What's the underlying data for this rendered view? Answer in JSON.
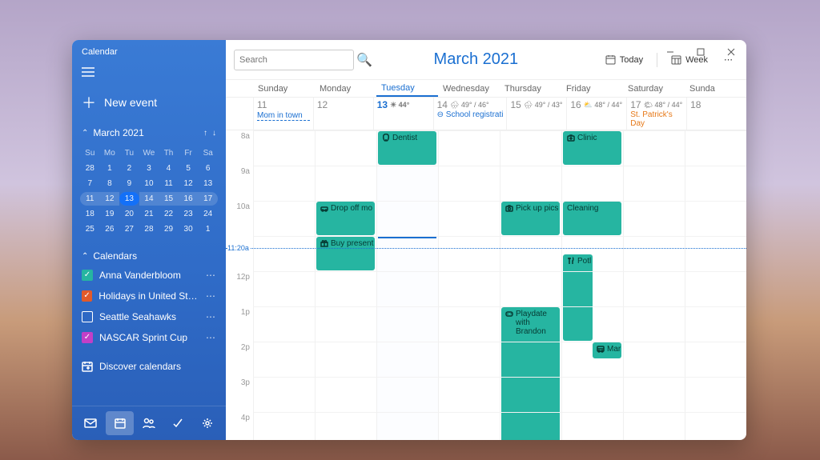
{
  "app": {
    "title": "Calendar"
  },
  "sidebar": {
    "newEvent": "New event",
    "month": "March 2021",
    "weekdays": [
      "Su",
      "Mo",
      "Tu",
      "We",
      "Th",
      "Fr",
      "Sa"
    ],
    "miniRows": [
      [
        "28",
        "1",
        "2",
        "3",
        "4",
        "5",
        "6"
      ],
      [
        "7",
        "8",
        "9",
        "10",
        "11",
        "12",
        "13"
      ],
      [
        "11",
        "12",
        "13",
        "14",
        "15",
        "16",
        "17"
      ],
      [
        "18",
        "19",
        "20",
        "21",
        "22",
        "23",
        "24"
      ],
      [
        "25",
        "26",
        "27",
        "28",
        "29",
        "30",
        "1"
      ]
    ],
    "todayIdx": [
      2,
      2
    ],
    "currentWeek": 2,
    "calendarsHeader": "Calendars",
    "calendars": [
      {
        "label": "Anna Vanderbloom",
        "color": "#26b5a1",
        "checked": true
      },
      {
        "label": "Holidays in United States",
        "color": "#e25a2a",
        "checked": true
      },
      {
        "label": "Seattle Seahawks",
        "color": "transparent",
        "checked": false
      },
      {
        "label": "NASCAR Sprint Cup",
        "color": "#c23fc7",
        "checked": true
      }
    ],
    "discover": "Discover calendars"
  },
  "toolbar": {
    "search_placeholder": "Search",
    "monthTitle": "March 2021",
    "today": "Today",
    "view": "Week"
  },
  "headers": [
    "Sunday",
    "Monday",
    "Tuesday",
    "Wednesday",
    "Thursday",
    "Friday",
    "Saturday",
    "Sunda"
  ],
  "todayCol": 2,
  "allday": [
    {
      "num": "11",
      "events": [
        {
          "text": "Mom in town",
          "dashed": true
        }
      ]
    },
    {
      "num": "12",
      "events": []
    },
    {
      "num": "13",
      "today": true,
      "weather": "☀ 44°",
      "events": []
    },
    {
      "num": "14",
      "weather": "🌧 49° / 46°",
      "events": [
        {
          "text": "⊖ School registrati",
          "link": true
        }
      ]
    },
    {
      "num": "15",
      "weather": "🌧 49° / 43°",
      "events": []
    },
    {
      "num": "16",
      "weather": "⛅ 48° / 44°",
      "events": []
    },
    {
      "num": "17",
      "weather": "🌤 48° / 44°",
      "events": [
        {
          "text": "St. Patrick's Day",
          "holiday": true
        }
      ]
    },
    {
      "num": "18",
      "events": []
    }
  ],
  "hours": [
    "8a",
    "9a",
    "10a",
    "",
    "12p",
    "1p",
    "2p",
    "3p",
    "4p"
  ],
  "nowLabel": "11:20a",
  "events": [
    {
      "col": 1,
      "row": 2,
      "span": 1,
      "icon": "car",
      "label": "Drop off mo"
    },
    {
      "col": 1,
      "row": 3,
      "span": 1,
      "slot": "bottom",
      "icon": "gift",
      "label": "Buy present"
    },
    {
      "col": 2,
      "row": 0,
      "span": 1,
      "icon": "tooth",
      "label": "Dentist"
    },
    {
      "col": 4,
      "row": 2,
      "span": 1,
      "icon": "camera",
      "label": "Pick up pics"
    },
    {
      "col": 4,
      "row": 5,
      "span": 4,
      "icon": "game",
      "label": "Playdate with Brandon",
      "wrap": true
    },
    {
      "col": 5,
      "row": 0,
      "span": 1,
      "icon": "health",
      "label": "Clinic"
    },
    {
      "col": 5,
      "row": 2,
      "span": 1,
      "icon": "",
      "label": "Cleaning"
    },
    {
      "col": 5,
      "row": 3.5,
      "span": 2.5,
      "icon": "fork",
      "label": "Potl",
      "half": true
    },
    {
      "col": 5,
      "row": 6,
      "span": 0.5,
      "icon": "bus",
      "label": "Mar",
      "halfr": true
    }
  ]
}
